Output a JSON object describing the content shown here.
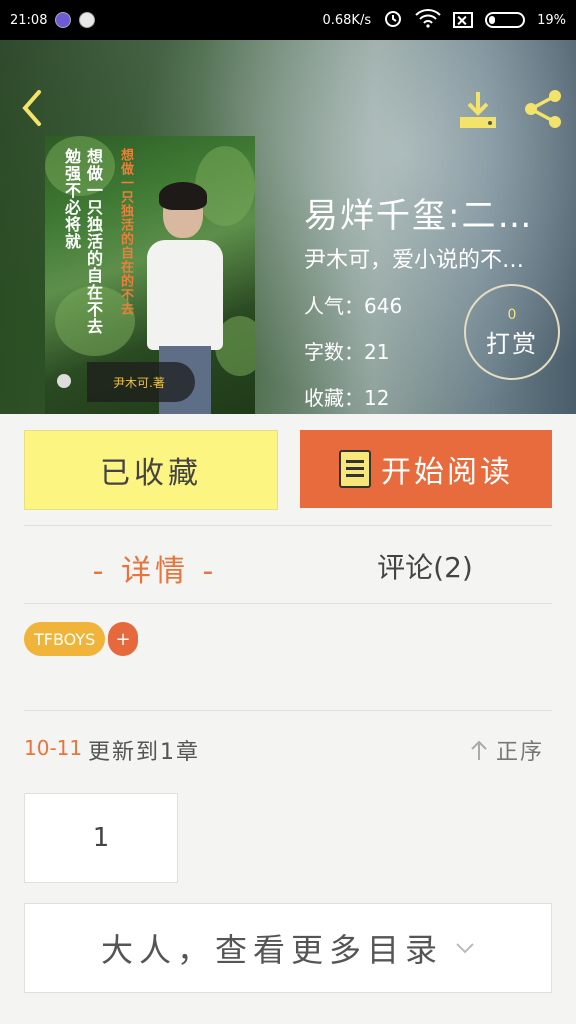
{
  "status_bar": {
    "time": "21:08",
    "net_speed": "0.68K/s",
    "battery": "19%"
  },
  "book": {
    "title": "易烊千玺:二…",
    "author_line": "尹木可，爱小说的不…",
    "popularity": "人气：646",
    "word_count": "字数：21",
    "favorites": "收藏：12",
    "cover": {
      "title_text": "想做一只独活的自在的不去",
      "line1": "想做一只独活的自在不去",
      "line2": "勉强不必将就",
      "author": "尹木可.著"
    }
  },
  "tip": {
    "count": "0",
    "label": "打赏"
  },
  "actions": {
    "favorited_label": "已收藏",
    "start_reading_label": "开始阅读"
  },
  "tabs": {
    "detail": "- 详情 -",
    "comments": "评论(2)"
  },
  "tags": {
    "items": [
      "TFBOYS"
    ],
    "add": "+"
  },
  "update": {
    "date": "10-11",
    "text": "更新到1章",
    "sort": "正序"
  },
  "chapters": [
    "1"
  ],
  "more_catalog": "大人，查看更多目录",
  "colors": {
    "accent_orange": "#e86b3d",
    "favorite_yellow": "#fdf582",
    "tag_orange": "#f0b43a"
  }
}
